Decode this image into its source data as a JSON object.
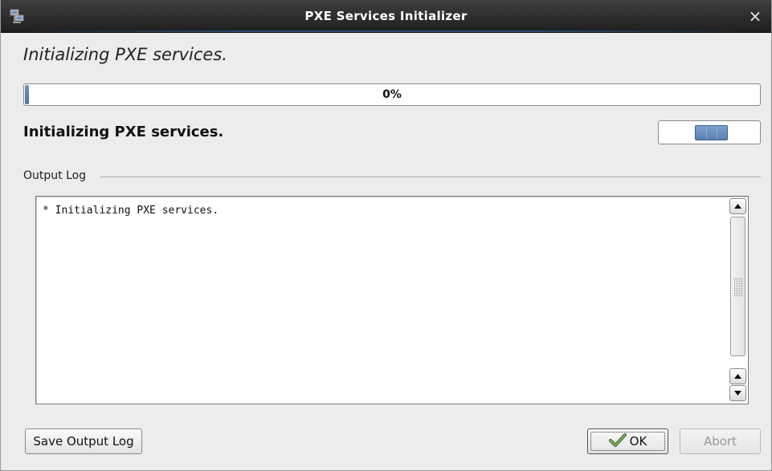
{
  "window": {
    "title": "PXE Services Initializer",
    "close_symbol": "×",
    "app_icon": "network-computers-icon"
  },
  "heading": "Initializing PXE services.",
  "progress": {
    "label": "0%",
    "value": 0
  },
  "status_text": "Initializing PXE services.",
  "activity_indicator": "indeterminate",
  "output_log": {
    "label": "Output Log",
    "content": "* Initializing PXE services."
  },
  "buttons": {
    "save_output_log": "Save Output Log",
    "ok": "OK",
    "abort": "Abort"
  },
  "colors": {
    "titlebar": "#2b2b2b",
    "progress_accent": "#5b80b3",
    "window_bg": "#ececec"
  }
}
